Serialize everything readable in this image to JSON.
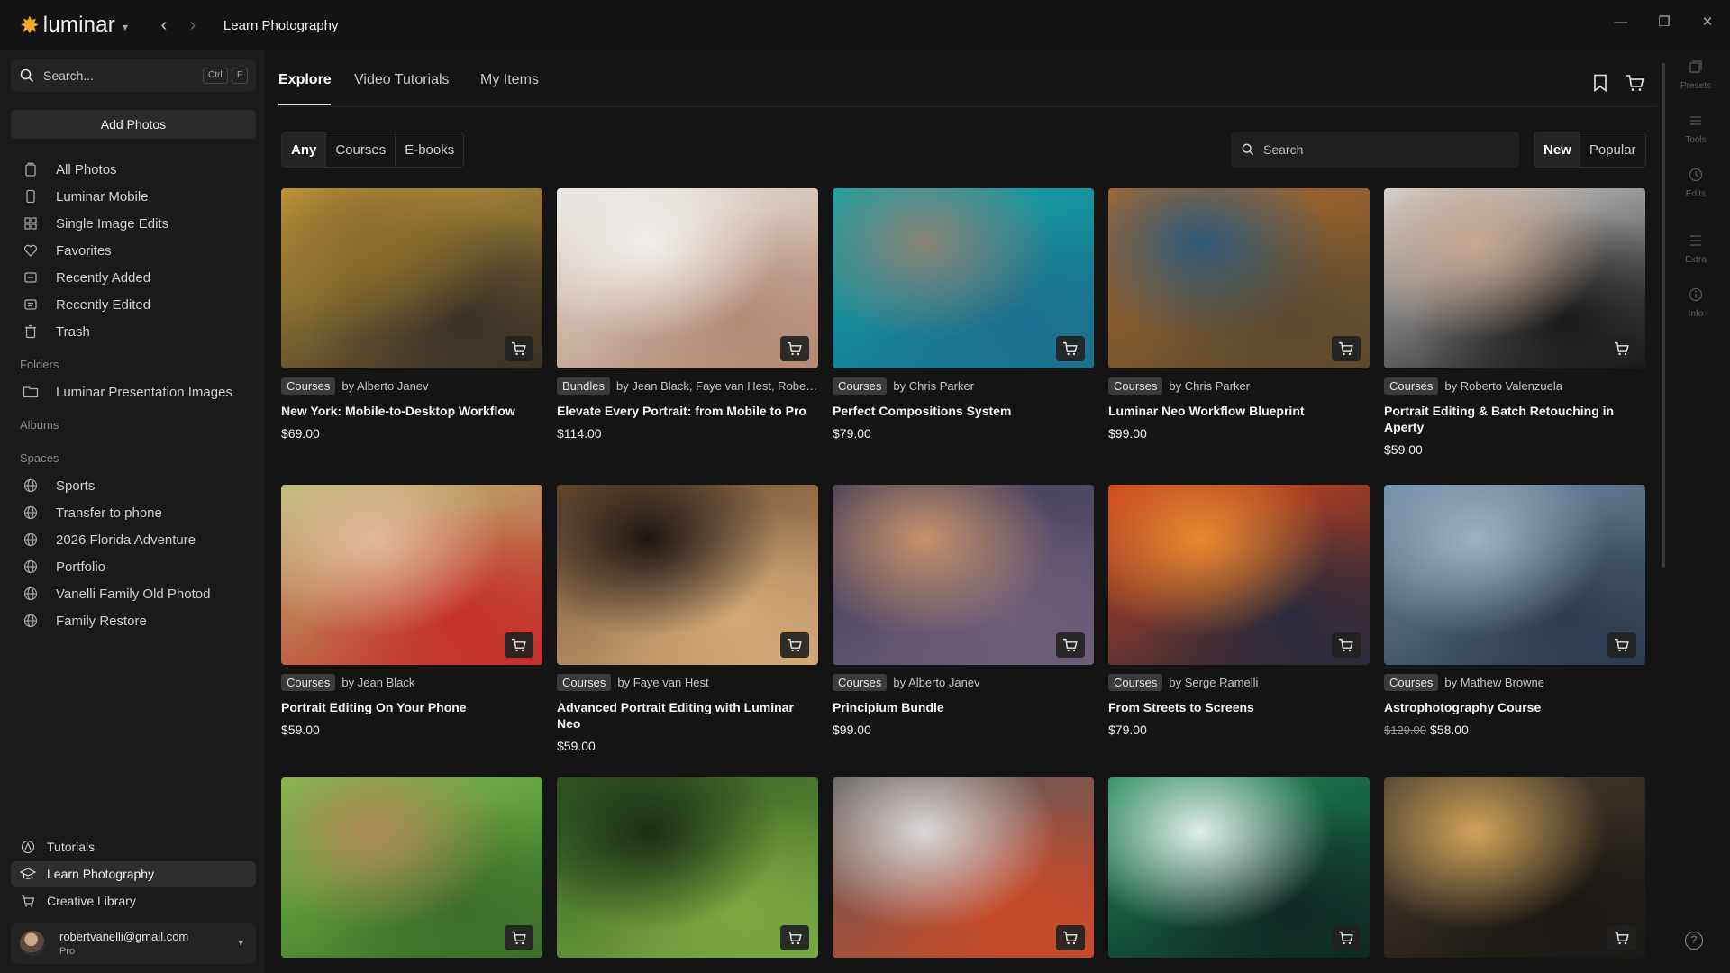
{
  "app": {
    "logo": "luminar",
    "window_title": "Learn Photography"
  },
  "sidebar": {
    "search_placeholder": "Search...",
    "shortcut_keys": [
      "Ctrl",
      "F"
    ],
    "add_photos": "Add Photos",
    "library": [
      {
        "label": "All Photos",
        "icon": "photo-stack-icon"
      },
      {
        "label": "Luminar Mobile",
        "icon": "phone-icon"
      },
      {
        "label": "Single Image Edits",
        "icon": "grid-icon"
      },
      {
        "label": "Favorites",
        "icon": "heart-icon"
      },
      {
        "label": "Recently Added",
        "icon": "recently-added-icon"
      },
      {
        "label": "Recently Edited",
        "icon": "recently-edited-icon"
      },
      {
        "label": "Trash",
        "icon": "trash-icon"
      }
    ],
    "folders_heading": "Folders",
    "folders": [
      {
        "label": "Luminar Presentation Images",
        "icon": "folder-icon"
      }
    ],
    "albums_heading": "Albums",
    "spaces_heading": "Spaces",
    "spaces": [
      {
        "label": "Sports",
        "icon": "globe-icon"
      },
      {
        "label": "Transfer to phone",
        "icon": "globe-icon"
      },
      {
        "label": "2026 Florida Adventure",
        "icon": "globe-icon"
      },
      {
        "label": "Portfolio",
        "icon": "globe-icon"
      },
      {
        "label": "Vanelli Family Old Photod",
        "icon": "globe-icon"
      },
      {
        "label": "Family Restore",
        "icon": "globe-icon"
      }
    ],
    "bottom": [
      {
        "label": "Tutorials",
        "icon": "tutorials-icon",
        "active": false
      },
      {
        "label": "Learn Photography",
        "icon": "graduation-cap-icon",
        "active": true
      },
      {
        "label": "Creative Library",
        "icon": "shopping-cart-icon",
        "active": false
      }
    ],
    "account": {
      "email": "robertvanelli@gmail.com",
      "plan": "Pro"
    }
  },
  "main": {
    "tabs": [
      "Explore",
      "Video Tutorials",
      "My Items"
    ],
    "active_tab": "Explore",
    "filters": [
      "Any",
      "Courses",
      "E-books"
    ],
    "active_filter": "Any",
    "search_placeholder": "Search",
    "sort": [
      "New",
      "Popular"
    ],
    "active_sort": "New"
  },
  "cards": [
    {
      "badge": "Courses",
      "author": "by Alberto Janev",
      "title": "New York: Mobile-to-Desktop Workflow",
      "price": "$69.00",
      "thumb_colors": [
        "#c69b3a",
        "#3a3328",
        "#8c6a2a"
      ]
    },
    {
      "badge": "Bundles",
      "author": "by Jean Black, Faye van Hest, Roberto Valenzu...",
      "title": "Elevate Every Portrait: from Mobile to Pro",
      "price": "$114.00",
      "thumb_colors": [
        "#e8e6e2",
        "#b48a74",
        "#f2f0ec"
      ]
    },
    {
      "badge": "Courses",
      "author": "by Chris Parker",
      "title": "Perfect Compositions System",
      "price": "$79.00",
      "thumb_colors": [
        "#14a6a9",
        "#1a6f8d",
        "#8a8375"
      ]
    },
    {
      "badge": "Courses",
      "author": "by Chris Parker",
      "title": "Luminar Neo Workflow Blueprint",
      "price": "$99.00",
      "thumb_colors": [
        "#b06b2e",
        "#5c4a2e",
        "#2f5a78"
      ]
    },
    {
      "badge": "Courses",
      "author": "by Roberto Valenzuela",
      "title": "Portrait Editing & Batch Retouching in Aperty",
      "price": "$59.00",
      "thumb_colors": [
        "#d9d9d9",
        "#1a1a1a",
        "#c8a890"
      ]
    },
    {
      "badge": "Courses",
      "author": "by Jean Black",
      "title": "Portrait Editing On Your Phone",
      "price": "$59.00",
      "thumb_colors": [
        "#b8c07a",
        "#c52f2a",
        "#e3b99a"
      ]
    },
    {
      "badge": "Courses",
      "author": "by Faye van Hest",
      "title": "Advanced Portrait Editing with Luminar Neo",
      "price": "$59.00",
      "thumb_colors": [
        "#6a4a2e",
        "#d4a878",
        "#1d1714"
      ]
    },
    {
      "badge": "Courses",
      "author": "by Alberto Janev",
      "title": "Principium Bundle",
      "price": "$99.00",
      "thumb_colors": [
        "#3b3a55",
        "#6f5f78",
        "#c9916b"
      ]
    },
    {
      "badge": "Courses",
      "author": "by Serge Ramelli",
      "title": "From Streets to Screens",
      "price": "$79.00",
      "thumb_colors": [
        "#d0421c",
        "#2a2a3a",
        "#e88a30"
      ]
    },
    {
      "badge": "Courses",
      "author": "by Mathew Browne",
      "title": "Astrophotography Course",
      "old_price": "$129.00",
      "price": "$58.00",
      "thumb_colors": [
        "#6f8ea8",
        "#2e3d4d",
        "#9cb2c6"
      ]
    },
    {
      "badge": "",
      "author": "",
      "title": "",
      "price": "",
      "thumb_colors": [
        "#7fc04a",
        "#3a6e2a",
        "#b08a5a"
      ]
    },
    {
      "badge": "",
      "author": "",
      "title": "",
      "price": "",
      "thumb_colors": [
        "#2e5a22",
        "#7aa840",
        "#1a2e14"
      ]
    },
    {
      "badge": "",
      "author": "",
      "title": "",
      "price": "",
      "thumb_colors": [
        "#5a5a5a",
        "#c84a2a",
        "#d8d8d8"
      ]
    },
    {
      "badge": "",
      "author": "",
      "title": "",
      "price": "",
      "thumb_colors": [
        "#1f8a5a",
        "#0e2a24",
        "#dfeee8"
      ]
    },
    {
      "badge": "",
      "author": "",
      "title": "",
      "price": "",
      "thumb_colors": [
        "#4a3f30",
        "#1a1714",
        "#d2a25a"
      ]
    }
  ],
  "right_panel": [
    {
      "label": "Presets",
      "icon": "presets-icon"
    },
    {
      "label": "Tools",
      "icon": "tools-icon"
    },
    {
      "label": "Edits",
      "icon": "edits-icon"
    },
    {
      "label": "Extra",
      "icon": "extra-icon"
    },
    {
      "label": "Info",
      "icon": "info-icon"
    }
  ],
  "colors": {
    "accent": "#f5a623",
    "background": "#141414",
    "sidebar": "#1a1a1a"
  }
}
